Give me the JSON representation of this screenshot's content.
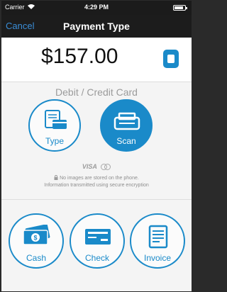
{
  "status_bar": {
    "carrier": "Carrier",
    "time": "4:29 PM",
    "wifi_icon": "wifi-icon",
    "battery_icon": "battery-icon"
  },
  "nav": {
    "cancel_label": "Cancel",
    "title": "Payment Type"
  },
  "amount": {
    "value": "$157.00",
    "keypad_icon": "keypad-icon"
  },
  "card_section": {
    "title": "Debit / Credit Card",
    "options": [
      {
        "label": "Type",
        "icon": "card-form-icon"
      },
      {
        "label": "Scan",
        "icon": "scanner-icon"
      }
    ],
    "brands": "VISA",
    "notice_line1": "No images are stored on the phone.",
    "notice_line2": "Information transmitted using secure encryption"
  },
  "other_methods": [
    {
      "label": "Cash",
      "icon": "cash-icon"
    },
    {
      "label": "Check",
      "icon": "check-icon"
    },
    {
      "label": "Invoice",
      "icon": "invoice-icon"
    }
  ],
  "colors": {
    "accent": "#1a8ac9",
    "nav_background": "#1c1c1c",
    "muted_text": "#9b9b9b"
  }
}
